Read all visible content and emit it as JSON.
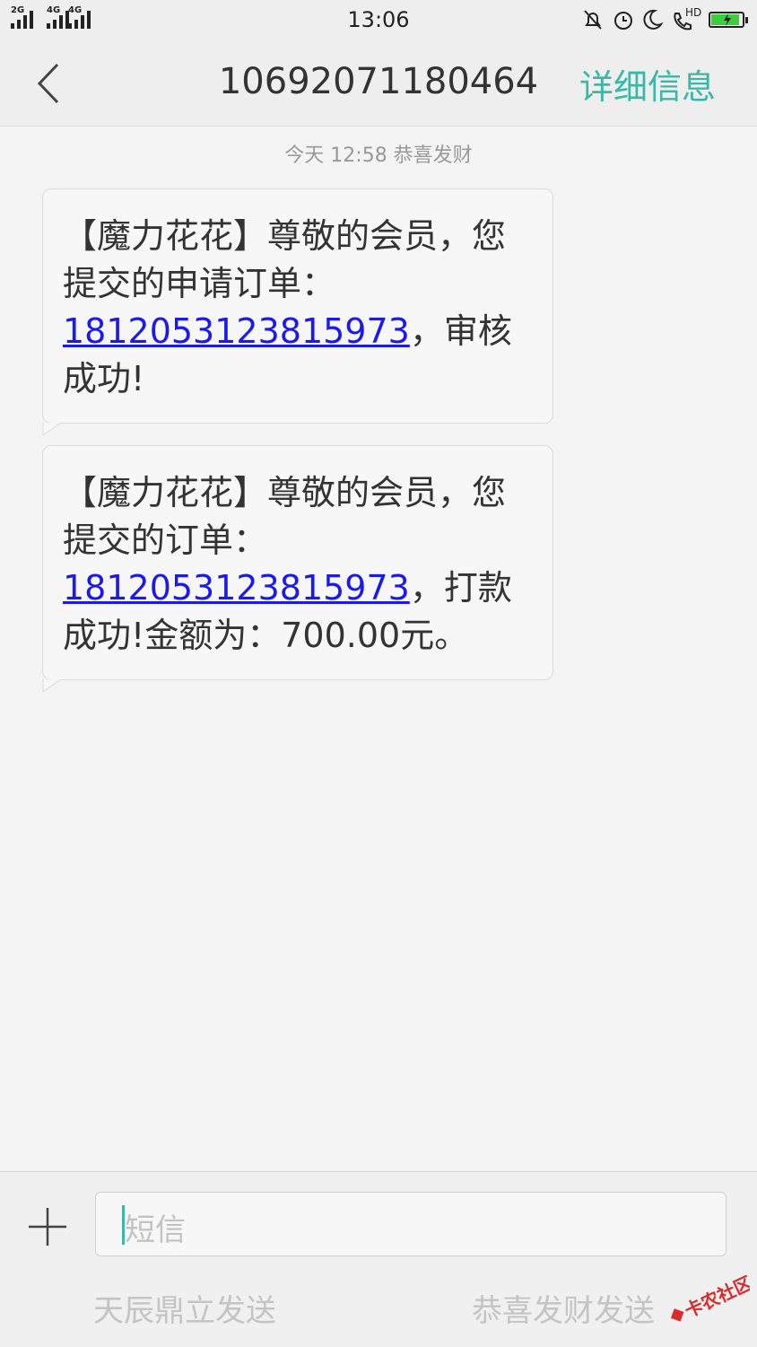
{
  "status_bar": {
    "sim1_label": "2G",
    "sim2_label": "4G",
    "sim2_label_b": "4G",
    "time": "13:06",
    "hd_label": "HD",
    "icons": [
      "bell-off-icon",
      "alarm-icon",
      "moon-icon",
      "phone-hd-icon",
      "battery-charging-icon"
    ],
    "battery_level": 0.9
  },
  "header": {
    "back_icon": "chevron-left-icon",
    "title": "10692071180464",
    "details_label": "详细信息"
  },
  "conversation": {
    "timestamp": "今天  12:58  恭喜发财",
    "messages": [
      {
        "text_before": "【魔力花花】尊敬的会员，您提交的申请订单：",
        "order_no": "1812053123815973",
        "text_after": "，审核成功!"
      },
      {
        "text_before": "【魔力花花】尊敬的会员，您提交的订单：",
        "order_no": "1812053123815973",
        "text_after": "，打款成功!金额为：700.00元。"
      }
    ]
  },
  "composer": {
    "add_icon": "plus-icon",
    "placeholder": "短信",
    "send_sim1": "天辰鼎立发送",
    "send_sim2": "恭喜发财发送"
  },
  "colors": {
    "accent": "#3bb7a6",
    "link": "#1a1aee",
    "background": "#f4f4f4"
  }
}
